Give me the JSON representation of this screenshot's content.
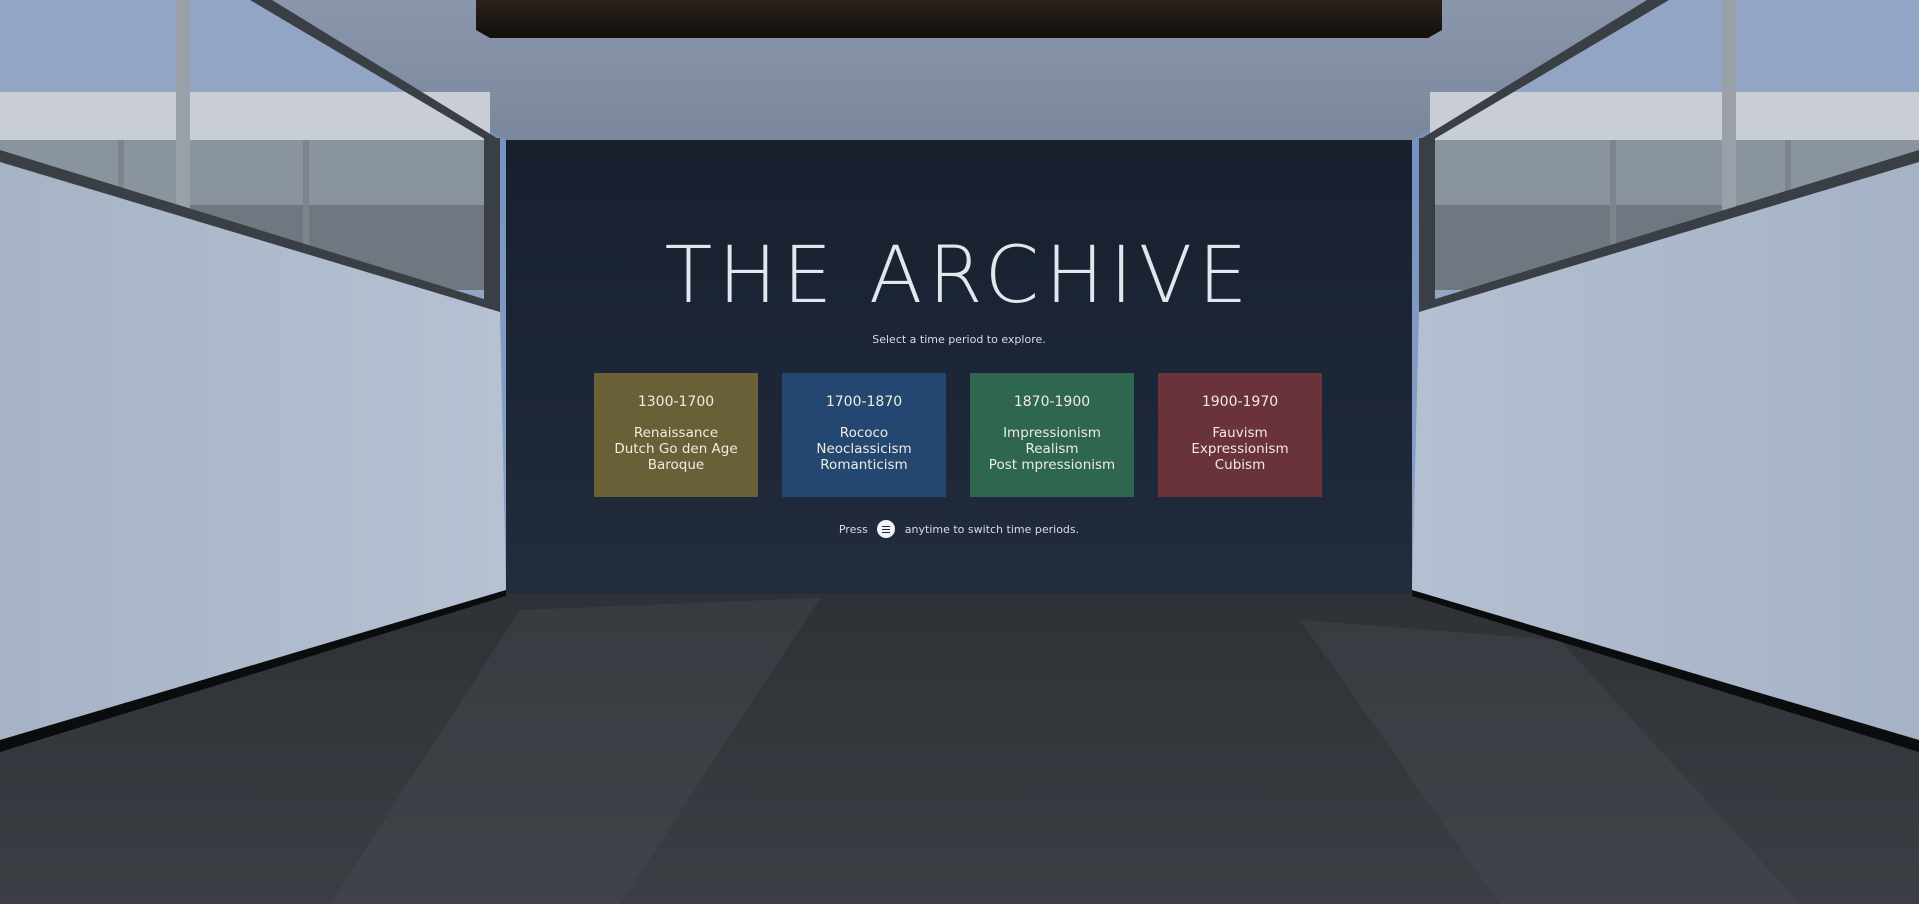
{
  "title": "THE ARCHIVE",
  "subtitle": "Select a time period to explore.",
  "periods": [
    {
      "range": "1300-1700",
      "styles": [
        "Renaissance",
        "Dutch Go den Age",
        "Baroque"
      ],
      "color": "#696038"
    },
    {
      "range": "1700-1870",
      "styles": [
        "Rococo",
        "Neoclassicism",
        "Romanticism"
      ],
      "color": "#234770"
    },
    {
      "range": "1870-1900",
      "styles": [
        "Impressionism",
        "Realism",
        "Post mpressionism"
      ],
      "color": "#2e6650"
    },
    {
      "range": "1900-1970",
      "styles": [
        "Fauvism",
        "Expressionism",
        "Cubism"
      ],
      "color": "#6a323b"
    }
  ],
  "hint": {
    "before": "Press",
    "icon": "menu-icon",
    "after": "anytime to switch time periods."
  }
}
